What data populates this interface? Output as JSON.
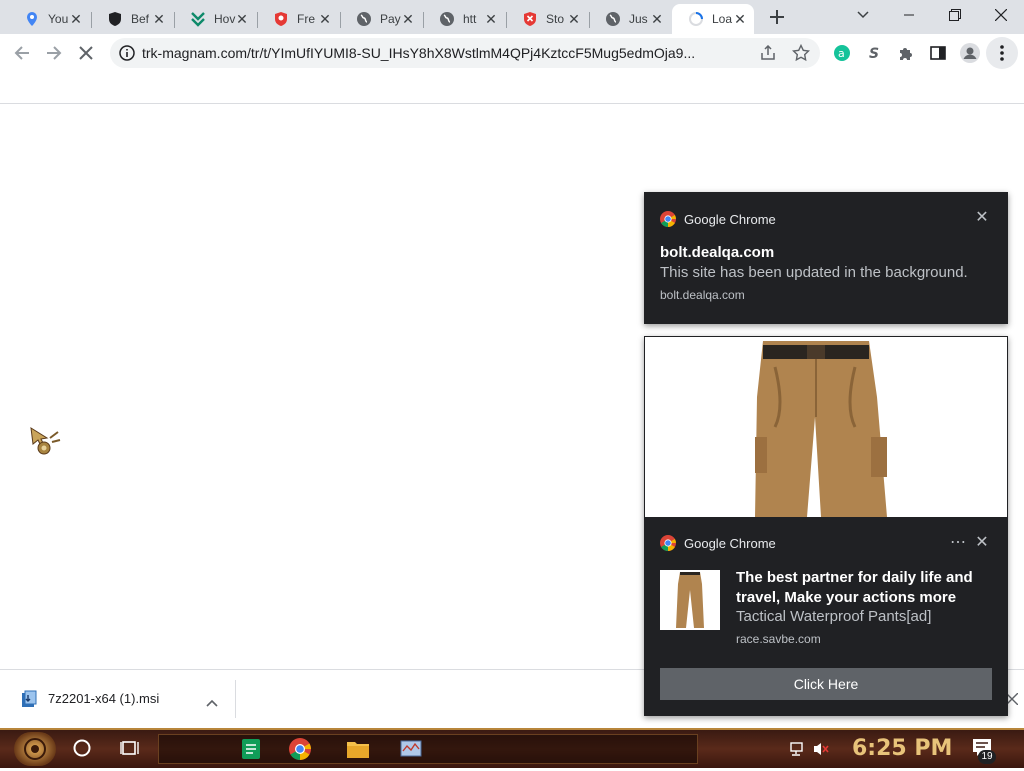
{
  "tabs": [
    {
      "title": "You",
      "icon": "map-pin-icon"
    },
    {
      "title": "Bef",
      "icon": "shield-icon"
    },
    {
      "title": "Hov",
      "icon": "leaf-logo-icon"
    },
    {
      "title": "Fre",
      "icon": "red-shield-icon"
    },
    {
      "title": "Pay",
      "icon": "globe-icon"
    },
    {
      "title": "htt",
      "icon": "globe-icon"
    },
    {
      "title": "Sto",
      "icon": "red-shield-x-icon"
    },
    {
      "title": "Jus",
      "icon": "globe-icon"
    },
    {
      "title": "Loa",
      "icon": "loading-spinner-icon",
      "active": true
    }
  ],
  "toolbar": {
    "url": "trk-magnam.com/tr/t/YImUfIYUMI8-SU_IHsY8hX8WstlmM4QPj4KztccF5Mug5edmOja9..."
  },
  "notifications": [
    {
      "app": "Google Chrome",
      "title": "bolt.dealqa.com",
      "message": "This site has been updated in the background.",
      "source": "bolt.dealqa.com"
    },
    {
      "app": "Google Chrome",
      "title": "The best partner for daily life and travel, Make your actions more conve",
      "message": "Tactical Waterproof Pants[ad]",
      "source": "race.savbe.com",
      "button": "Click Here"
    }
  ],
  "downloads": {
    "file_name": "7z2201-x64 (1).msi"
  },
  "taskbar": {
    "clock": "6:25 PM",
    "notification_count": "19"
  },
  "colors": {
    "notification_bg": "#202124",
    "tabstrip_bg": "#dee1e6",
    "pants_khaki": "#b0844f",
    "taskbar_clock": "#e8c37a"
  }
}
